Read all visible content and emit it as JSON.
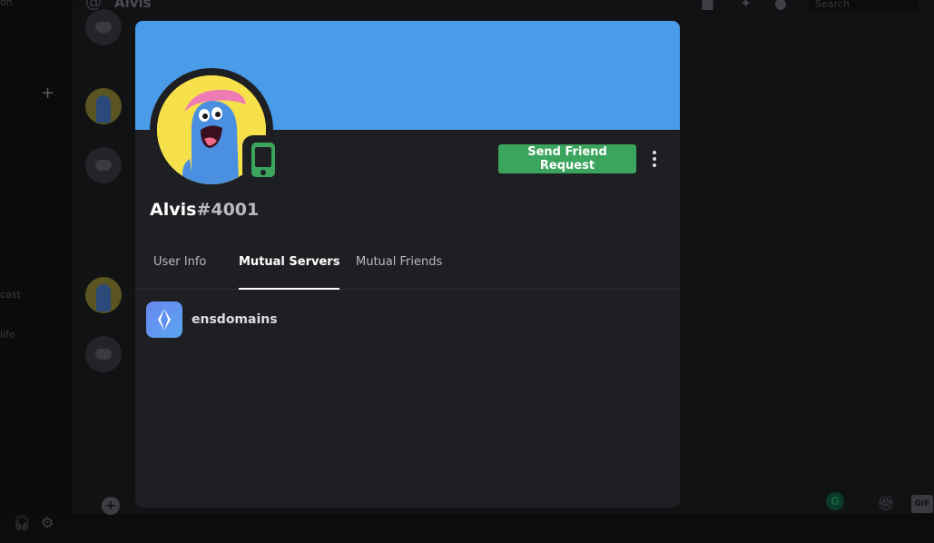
{
  "background": {
    "title": "Alvis",
    "search_placeholder": "Search",
    "channel_fragments": [
      "on",
      "cast",
      "life"
    ],
    "gif_label": "GIF"
  },
  "profile": {
    "username": "Alvis",
    "discriminator": "#4001",
    "banner_color": "#4a9be8",
    "status": "mobile-online",
    "friend_button_label": "Send Friend Request",
    "friend_button_color": "#3ba55d"
  },
  "tabs": [
    {
      "label": "User Info",
      "active": false
    },
    {
      "label": "Mutual Servers",
      "active": true
    },
    {
      "label": "Mutual Friends",
      "active": false
    }
  ],
  "mutual_servers": [
    {
      "name": "ensdomains",
      "icon": "ens-logo-icon"
    }
  ]
}
